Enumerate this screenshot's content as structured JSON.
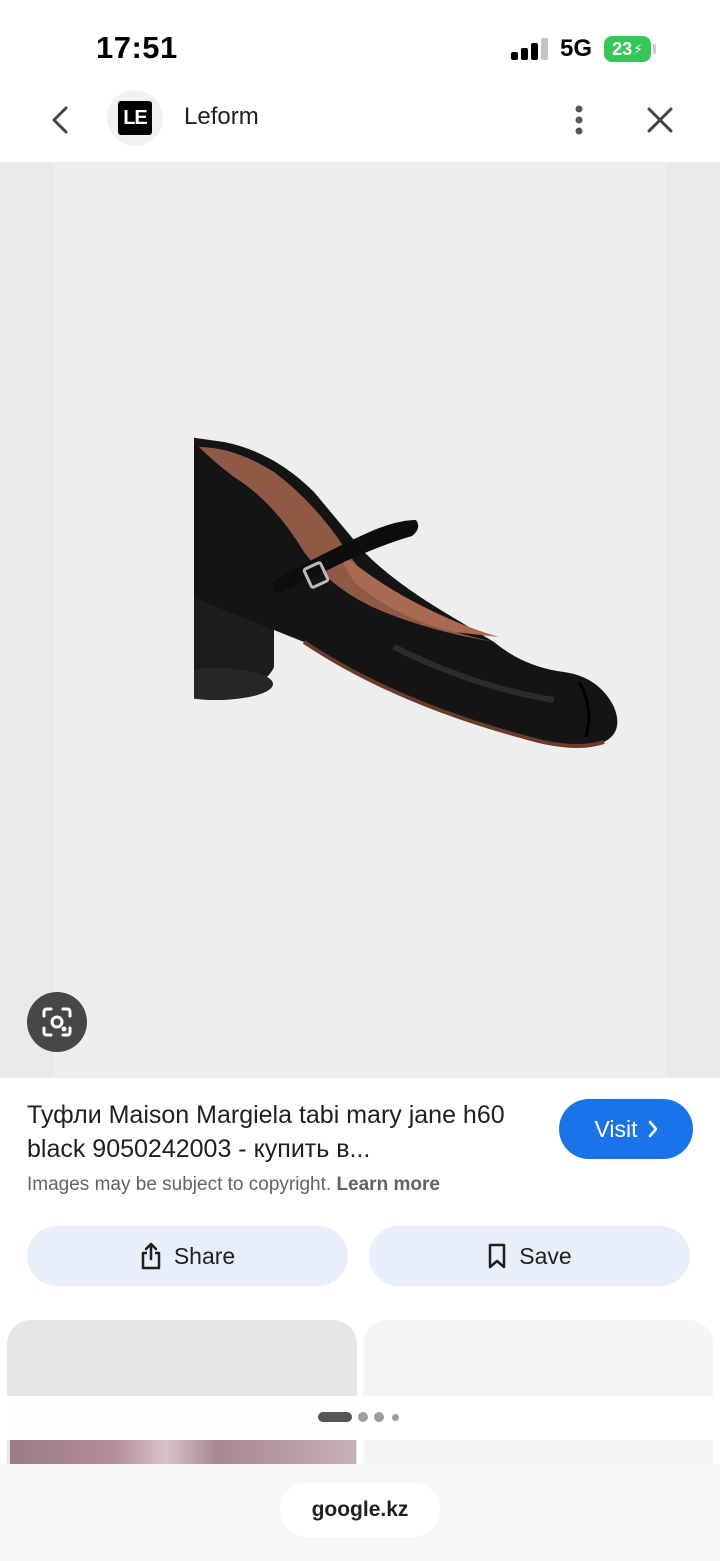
{
  "status_bar": {
    "time": "17:51",
    "network": "5G",
    "battery": "23"
  },
  "header": {
    "logo_text": "LE",
    "site_name": "Leform"
  },
  "image": {
    "subject": "shoe-image",
    "background_color": "#eeeeee"
  },
  "info": {
    "title": "Туфли Maison Margiela tabi mary jane h60 black 9050242003 - купить в...",
    "visit_label": "Visit",
    "copyright_text": "Images may be subject to copyright.",
    "learn_more": "Learn more",
    "share_label": "Share",
    "save_label": "Save"
  },
  "footer": {
    "url": "google.kz"
  },
  "colors": {
    "accent": "#1a73e8",
    "button_bg": "#e8effb",
    "battery": "#35c759"
  },
  "icons": [
    "back-icon",
    "more-vert-icon",
    "close-icon",
    "lens-icon",
    "chevron-right-icon",
    "share-icon",
    "bookmark-icon"
  ]
}
